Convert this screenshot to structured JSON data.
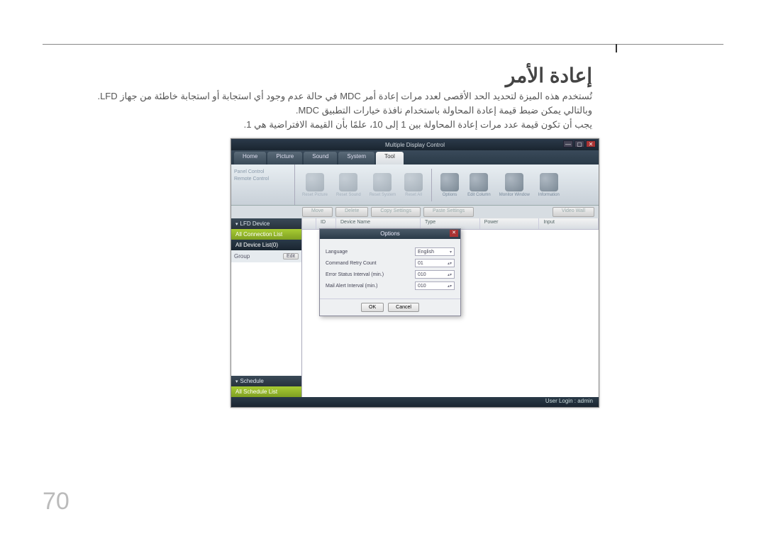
{
  "page": {
    "heading": "إعادة الأمر",
    "para1": "تُستخدم هذه الميزة لتحديد الحد الأقصى لعدد مرات إعادة أمر MDC في حالة عدم وجود أي استجابة أو استجابة خاطئة من جهاز LFD.",
    "para2": "وبالتالي يمكن ضبط قيمة إعادة المحاولة باستخدام نافذة خيارات التطبيق MDC.",
    "para3": "يجب أن تكون قيمة عدد مرات إعادة المحاولة بين 1 إلى 10، علمًا بأن القيمة الافتراضية هي 1.",
    "number": "70"
  },
  "app": {
    "title": "Multiple Display Control",
    "tabs": [
      "Home",
      "Picture",
      "Sound",
      "System",
      "Tool"
    ],
    "active_tab": 4,
    "toolbar_left": [
      "Panel Control",
      "Remote Control"
    ],
    "toolbar_buttons": [
      {
        "label": "Reset Picture",
        "faded": true
      },
      {
        "label": "Reset Sound",
        "faded": true
      },
      {
        "label": "Reset System",
        "faded": true
      },
      {
        "label": "Reset All",
        "faded": true
      },
      {
        "label": "Options",
        "faded": false
      },
      {
        "label": "Edit Column",
        "faded": false
      },
      {
        "label": "Monitor Window",
        "faded": false
      },
      {
        "label": "Information",
        "faded": false
      }
    ],
    "filter_buttons": [
      "Move",
      "Delete",
      "Copy Settings",
      "Paste Settings",
      "Video Wall"
    ],
    "sidebar": {
      "lfd_head": "LFD Device",
      "all_conn": "All Connection List",
      "all_dev": "All Device List(0)",
      "group_label": "Group",
      "edit_label": "Edit",
      "sched_head": "Schedule",
      "all_sched": "All Schedule List"
    },
    "table": {
      "cols": [
        "",
        "ID",
        "Device Name",
        "Type",
        "Power",
        "Input"
      ]
    },
    "status": "User Login : admin"
  },
  "dialog": {
    "title": "Options",
    "rows": [
      {
        "label": "Language",
        "value": "English",
        "type": "select"
      },
      {
        "label": "Command Retry Count",
        "value": "01",
        "type": "spin"
      },
      {
        "label": "Error Status Interval (min.)",
        "value": "010",
        "type": "spin"
      },
      {
        "label": "Mail Alert Interval (min.)",
        "value": "010",
        "type": "spin"
      }
    ],
    "ok": "OK",
    "cancel": "Cancel"
  }
}
